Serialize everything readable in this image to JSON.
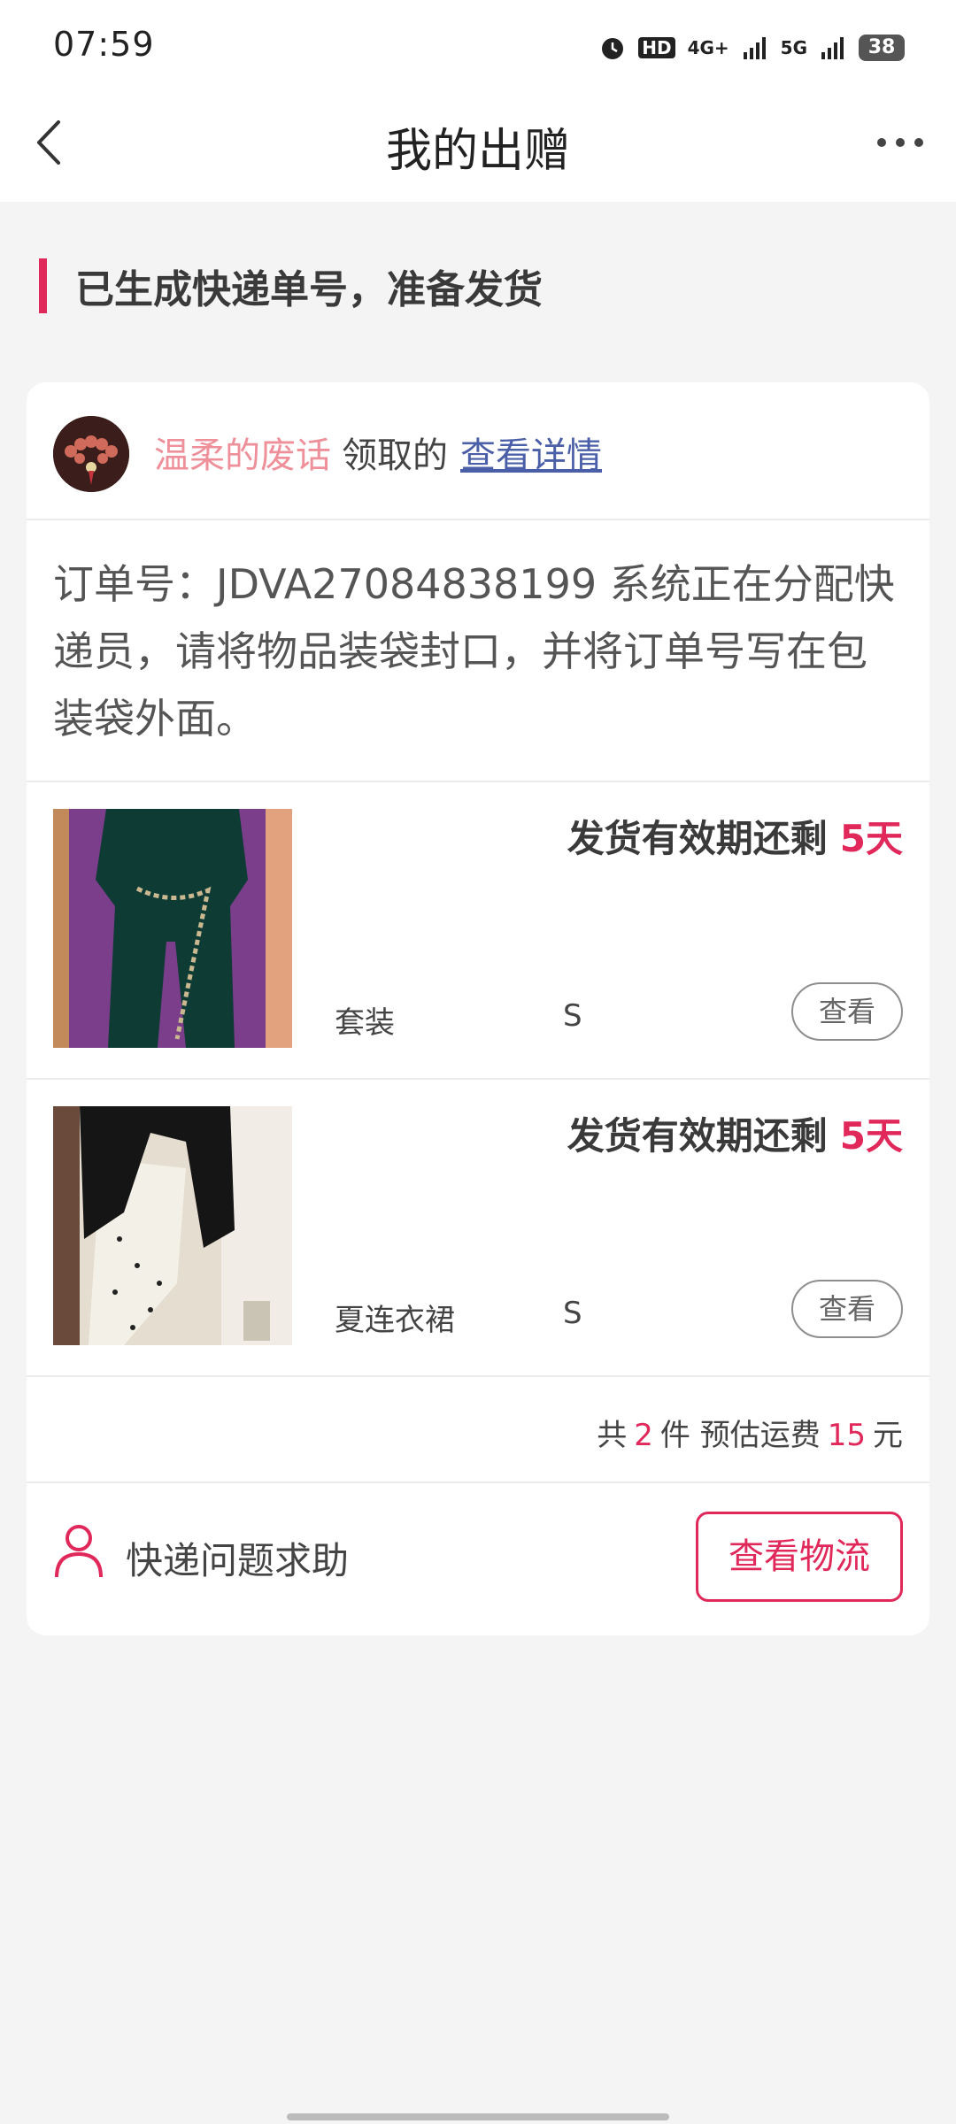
{
  "status_bar": {
    "time": "07:59",
    "hd_label": "HD",
    "sig1_label": "4G+",
    "sig2_label": "5G",
    "battery": "38"
  },
  "nav": {
    "title": "我的出赠",
    "back_icon": "chevron-left-icon",
    "more_icon": "more-dots-icon"
  },
  "section": {
    "title": "已生成快递单号，准备发货"
  },
  "receiver": {
    "name": "温柔的废话",
    "action": "领取的",
    "link": "查看详情"
  },
  "order": {
    "text": "订单号：JDVA27084838199 系统正在分配快递员，请将物品装袋封口，并将订单号写在包装袋外面。"
  },
  "items": [
    {
      "deadline_label": "发货有效期还剩",
      "deadline_days": "5天",
      "name": "套装",
      "size": "S",
      "view_label": "查看"
    },
    {
      "deadline_label": "发货有效期还剩",
      "deadline_days": "5天",
      "name": "夏连衣裙",
      "size": "S",
      "view_label": "查看"
    }
  ],
  "summary": {
    "prefix": "共",
    "count": "2",
    "unit": "件 预估运费",
    "fee": "15",
    "currency": "元"
  },
  "help": {
    "label": "快递问题求助",
    "icon": "person-icon"
  },
  "logistics_button": "查看物流",
  "colors": {
    "accent": "#e1285a",
    "link": "#4a5fa8",
    "receiver_name": "#ee8f9a"
  }
}
